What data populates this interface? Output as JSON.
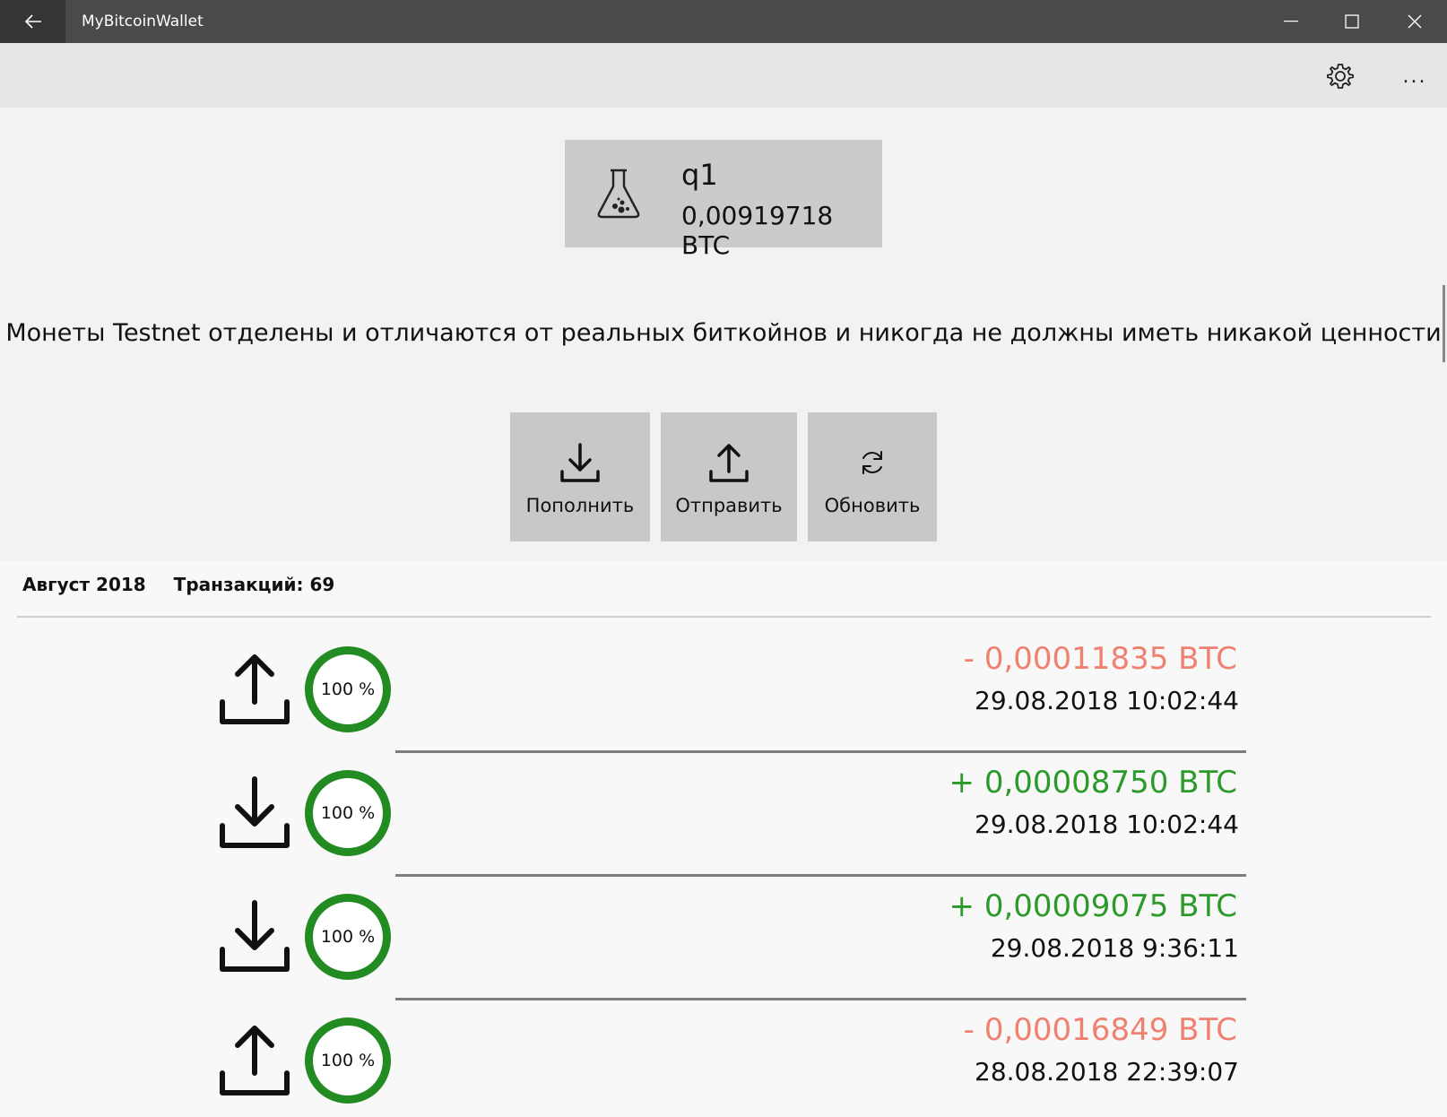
{
  "app": {
    "title": "MyBitcoinWallet",
    "back_icon": "arrow-left-icon"
  },
  "window_controls": {
    "minimize_icon": "minimize-icon",
    "maximize_icon": "maximize-icon",
    "close_icon": "close-icon"
  },
  "command_bar": {
    "settings_icon": "gear-icon",
    "more_label": "..."
  },
  "wallet": {
    "icon": "flask-icon",
    "name": "q1",
    "balance": "0,00919718 BTC"
  },
  "notice": "Монеты Testnet отделены и отличаются от реальных биткойнов и никогда не должны иметь никакой ценности",
  "actions": {
    "deposit_label": "Пополнить",
    "send_label": "Отправить",
    "refresh_label": "Обновить"
  },
  "transactions": {
    "month": "Август 2018",
    "count_label": "Транзакций: 69",
    "items": [
      {
        "direction": "out",
        "progress": "100 %",
        "amount": "- 0,00011835 BTC",
        "date": "29.08.2018 10:02:44"
      },
      {
        "direction": "in",
        "progress": "100 %",
        "amount": "+ 0,00008750 BTC",
        "date": "29.08.2018 10:02:44"
      },
      {
        "direction": "in",
        "progress": "100 %",
        "amount": "+ 0,00009075 BTC",
        "date": "29.08.2018 9:36:11"
      },
      {
        "direction": "out",
        "progress": "100 %",
        "amount": "- 0,00016849 BTC",
        "date": "28.08.2018 22:39:07"
      }
    ]
  },
  "colors": {
    "outgoing": "#f08070",
    "incoming": "#2b9a2b",
    "progress_ring": "#228b22"
  }
}
